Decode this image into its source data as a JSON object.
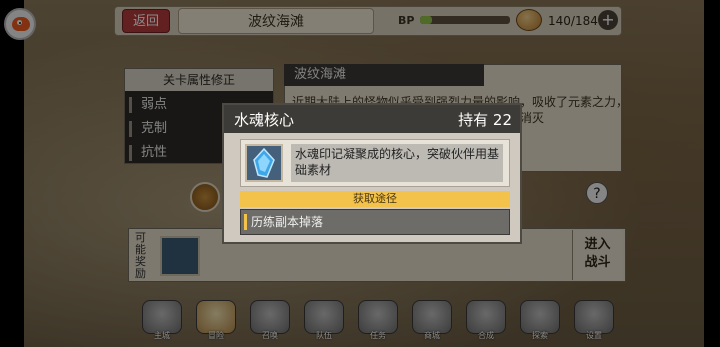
{
  "topbar": {
    "back_label": "返回",
    "stage_name": "波纹海滩",
    "bp_label": "BP",
    "bp_fill_fraction": 0.13,
    "stamina_text": "140/184",
    "plus_symbol": "+"
  },
  "attributes": {
    "title": "关卡属性修正",
    "rows": [
      {
        "label": "弱点",
        "value": "–"
      },
      {
        "label": "克制",
        "value": "–"
      },
      {
        "label": "抗性",
        "value": "–"
      }
    ]
  },
  "stage_info": {
    "tab_title": "波纹海滩",
    "description_lines": [
      "近期大陆上的怪物似乎受到强烈力量的影响，吸收了元素之力，",
      "变得更加强大。附近的居民都为此事，将其消灭"
    ]
  },
  "rewards": {
    "label": "可能奖励",
    "enter_label_1": "进入",
    "enter_label_2": "战斗"
  },
  "help_symbol": "?",
  "nav": [
    {
      "label": "主城",
      "icon": "castle-icon"
    },
    {
      "label": "冒险",
      "icon": "sword-icon",
      "active": true
    },
    {
      "label": "召唤",
      "icon": "summon-icon"
    },
    {
      "label": "队伍",
      "icon": "team-icon"
    },
    {
      "label": "任务",
      "icon": "quest-icon"
    },
    {
      "label": "商城",
      "icon": "shop-icon"
    },
    {
      "label": "合成",
      "icon": "craft-icon"
    },
    {
      "label": "探索",
      "icon": "explore-icon"
    },
    {
      "label": "设置",
      "icon": "settings-icon"
    }
  ],
  "modal": {
    "title": "水魂核心",
    "owned": "持有 22",
    "item_description": "水魂印记凝聚成的核心，突破伙伴用基础素材",
    "acquire_header": "获取途径",
    "acquire_source": "历练副本掉落"
  },
  "colors": {
    "accent_yellow": "#f2c24a",
    "back_red": "#b33b3b",
    "bp_green": "#92c24a"
  }
}
